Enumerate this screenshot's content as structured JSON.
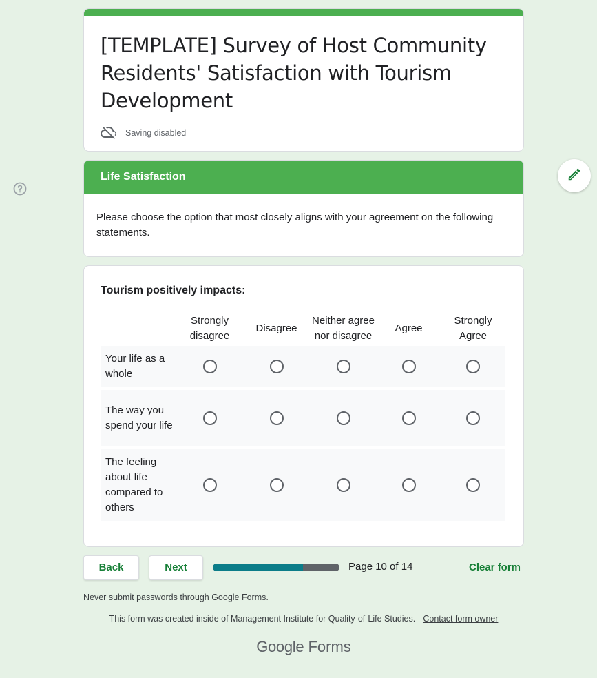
{
  "header": {
    "title": "[TEMPLATE] Survey of Host Community Residents' Satisfaction with Tourism Development",
    "saving_status": "Saving disabled"
  },
  "section": {
    "title": "Life Satisfaction",
    "description": "Please choose the option that most closely aligns with your agreement on the following statements."
  },
  "question": {
    "title": "Tourism positively impacts:",
    "columns": [
      "Strongly disagree",
      "Disagree",
      "Neither agree nor disagree",
      "Agree",
      "Strongly Agree"
    ],
    "rows": [
      "Your life as a whole",
      "The way you spend your life",
      "The feeling about life compared to others"
    ]
  },
  "navigation": {
    "back_label": "Back",
    "next_label": "Next",
    "page_indicator": "Page 10 of 14",
    "current_page": 10,
    "total_pages": 14,
    "progress_fraction": 0.71,
    "clear_label": "Clear form"
  },
  "footer": {
    "warning": "Never submit passwords through Google Forms.",
    "created_text": "This form was created inside of Management Institute for Quality-of-Life Studies. - ",
    "contact_link": "Contact form owner",
    "logo_google": "Google",
    "logo_forms": "Forms"
  },
  "icons": {
    "cloud_off": "cloud-off-icon",
    "help": "help-icon",
    "edit": "pencil-icon"
  },
  "colors": {
    "accent": "#4caf50",
    "button_text": "#188038",
    "progress": "#0b7d89",
    "background": "#e6f2e6"
  }
}
